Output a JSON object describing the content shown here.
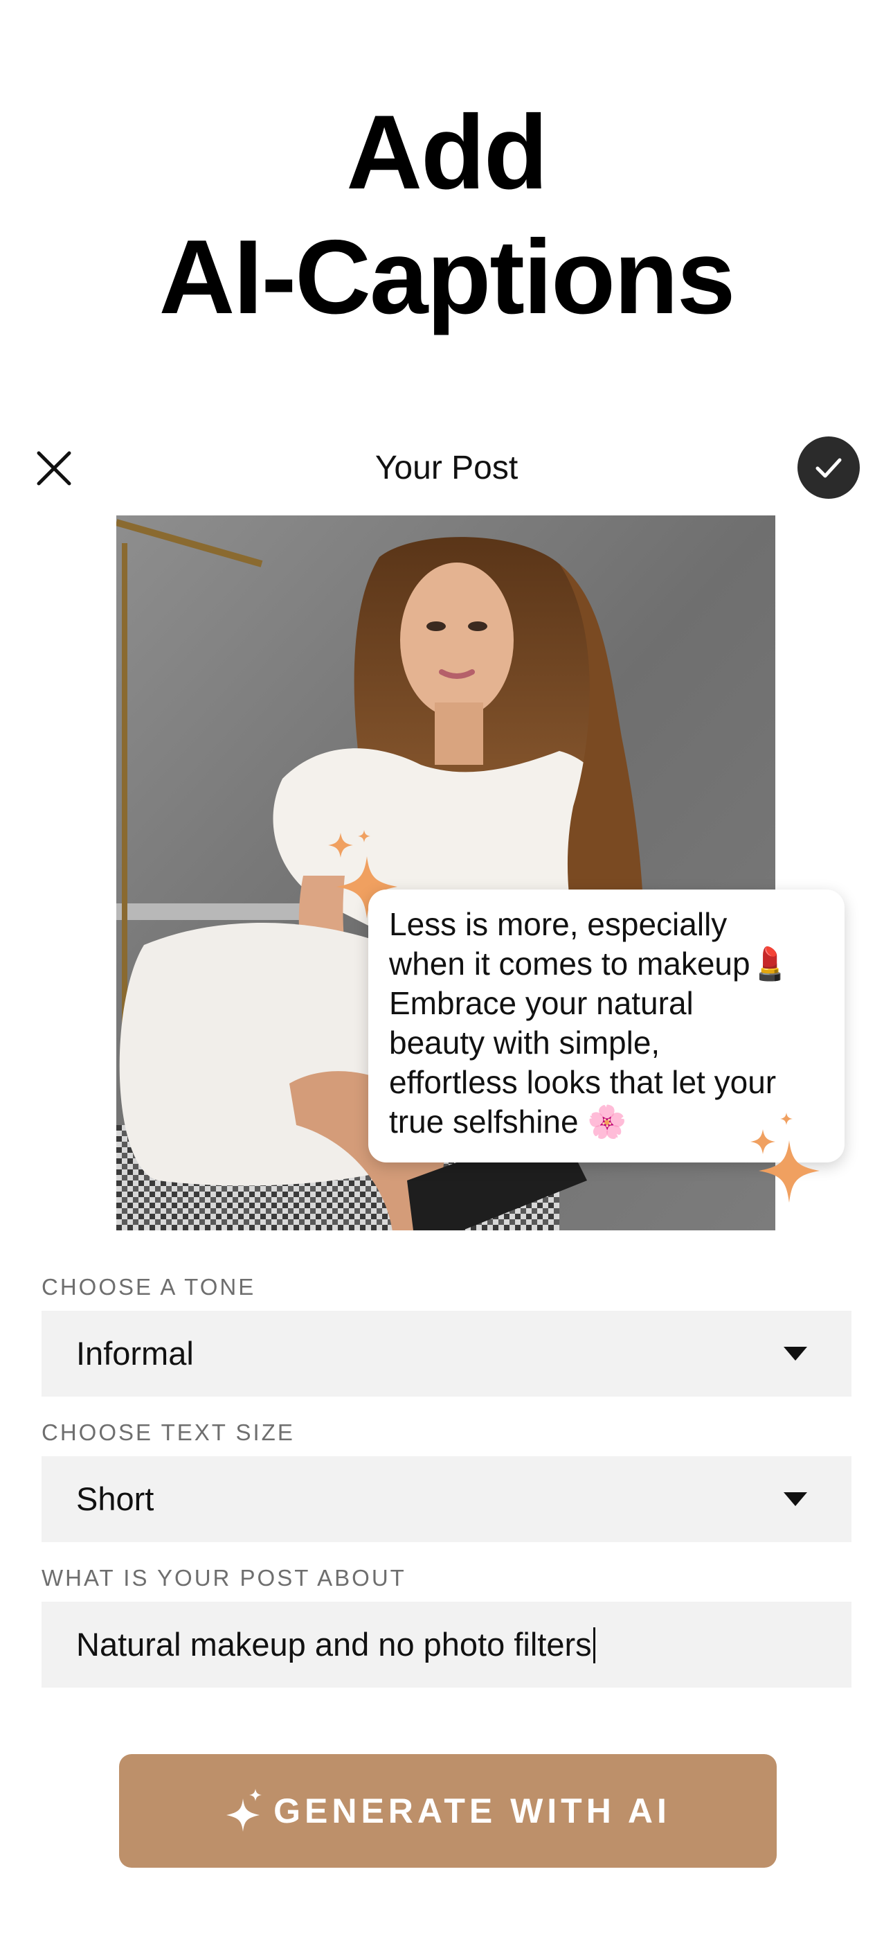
{
  "headline": {
    "line1": "Add",
    "line2": "AI-Captions"
  },
  "post_header": {
    "title": "Your Post",
    "close_icon": "close-icon",
    "confirm_icon": "checkmark-icon"
  },
  "caption": {
    "lines": [
      "Less is more, especially",
      "when it comes to makeup💄",
      "Embrace your natural",
      "beauty with simple,",
      "effortless looks that let your",
      "true selfshine 🌸"
    ]
  },
  "colors": {
    "accent": "#bd906a",
    "sparkle": "#f0a060",
    "field_bg": "#f2f2f2",
    "confirm_bg": "#2b2b2b"
  },
  "form": {
    "tone": {
      "label": "CHOOSE A TONE",
      "value": "Informal"
    },
    "text_size": {
      "label": "CHOOSE TEXT SIZE",
      "value": "Short"
    },
    "about": {
      "label": "WHAT IS YOUR POST ABOUT",
      "value": "Natural makeup and no photo filters"
    }
  },
  "generate_button": {
    "label": "GENERATE WITH AI",
    "icon": "sparkle-icon"
  }
}
